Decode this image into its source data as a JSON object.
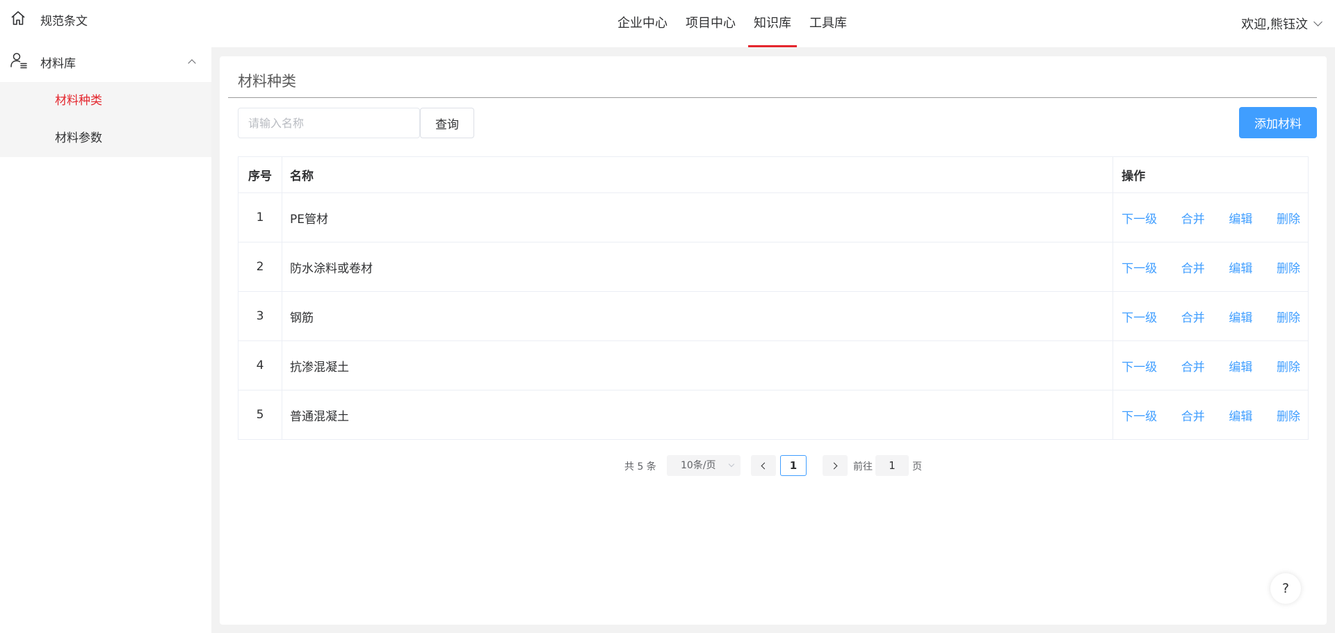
{
  "header": {
    "nav": [
      {
        "label": "企业中心",
        "active": false
      },
      {
        "label": "项目中心",
        "active": false
      },
      {
        "label": "知识库",
        "active": true
      },
      {
        "label": "工具库",
        "active": false
      }
    ],
    "user_greeting": "欢迎,熊钰汶",
    "accent_color": "#e4262d"
  },
  "sidebar": {
    "items": [
      {
        "label": "规范条文",
        "icon": "home-icon"
      },
      {
        "label": "材料库",
        "icon": "user-list-icon",
        "expanded": true,
        "children": [
          {
            "label": "材料种类",
            "active": true
          },
          {
            "label": "材料参数",
            "active": false
          }
        ]
      }
    ]
  },
  "main": {
    "title": "材料种类",
    "search": {
      "placeholder": "请输入名称",
      "value": ""
    },
    "query_button": "查询",
    "add_button": "添加材料",
    "primary_color": "#409eff",
    "table": {
      "columns": [
        "序号",
        "名称",
        "操作"
      ],
      "actions": [
        "下一级",
        "合并",
        "编辑",
        "删除"
      ],
      "rows": [
        {
          "index": "1",
          "name": "PE管材"
        },
        {
          "index": "2",
          "name": "防水涂料或卷材"
        },
        {
          "index": "3",
          "name": "钢筋"
        },
        {
          "index": "4",
          "name": "抗渗混凝土"
        },
        {
          "index": "5",
          "name": "普通混凝土"
        }
      ]
    },
    "pagination": {
      "total_text": "共 5 条",
      "page_size": "10条/页",
      "current_page": "1",
      "goto_label": "前往",
      "goto_value": "1",
      "page_unit": "页"
    }
  },
  "help": {
    "label": "?"
  }
}
